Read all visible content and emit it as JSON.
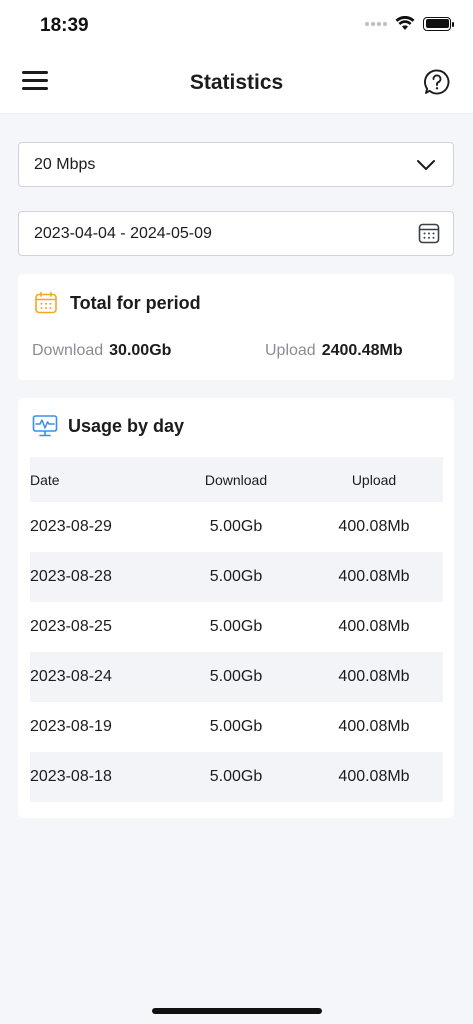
{
  "status_bar": {
    "time": "18:39"
  },
  "nav": {
    "title": "Statistics",
    "menu_icon": "hamburger-icon",
    "help_icon": "question-circle-icon"
  },
  "speed_select": {
    "value": "20 Mbps",
    "icon": "chevron-down-icon"
  },
  "date_range": {
    "value": "2023-04-04 - 2024-05-09",
    "icon": "calendar-icon"
  },
  "total": {
    "title": "Total for period",
    "icon": "calendar-icon",
    "download_label": "Download",
    "download_value": "30.00Gb",
    "upload_label": "Upload",
    "upload_value": "2400.48Mb"
  },
  "usage": {
    "title": "Usage by day",
    "icon": "monitor-pulse-icon",
    "columns": [
      "Date",
      "Download",
      "Upload"
    ],
    "rows": [
      [
        "2023-08-29",
        "5.00Gb",
        "400.08Mb"
      ],
      [
        "2023-08-28",
        "5.00Gb",
        "400.08Mb"
      ],
      [
        "2023-08-25",
        "5.00Gb",
        "400.08Mb"
      ],
      [
        "2023-08-24",
        "5.00Gb",
        "400.08Mb"
      ],
      [
        "2023-08-19",
        "5.00Gb",
        "400.08Mb"
      ],
      [
        "2023-08-18",
        "5.00Gb",
        "400.08Mb"
      ]
    ]
  },
  "colors": {
    "accent_orange": "#f5a623",
    "accent_blue": "#3a8ee6",
    "background": "#f5f6fa"
  }
}
